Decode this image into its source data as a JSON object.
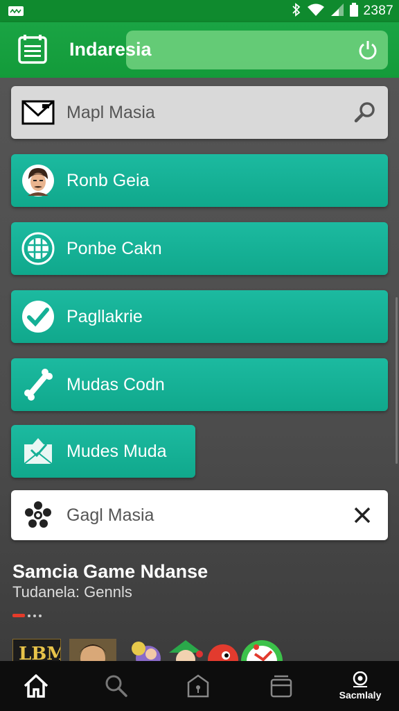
{
  "status_bar": {
    "time": "2387"
  },
  "app_bar": {
    "title": "Indaresia"
  },
  "search": {
    "placeholder": "Mapl Masia"
  },
  "menu_items": [
    {
      "label": "Ronb Geia",
      "icon": "avatar-icon"
    },
    {
      "label": "Ponbe Cakn",
      "icon": "grid-globe-icon"
    },
    {
      "label": "Pagllakrie",
      "icon": "check-icon"
    },
    {
      "label": "Mudas Codn",
      "icon": "bone-icon"
    },
    {
      "label": "Mudes Muda",
      "icon": "envelope-icon"
    }
  ],
  "filter_row": {
    "label": "Gagl Masia",
    "icon": "flower-icon",
    "close_icon": "close-icon"
  },
  "section": {
    "title": "Samcia Game Ndanse",
    "subtitle": "Tudanela: Gennls"
  },
  "game_tiles": [
    {
      "text": "LBM"
    },
    {
      "text": ""
    },
    {
      "text": ""
    },
    {
      "text": ""
    },
    {
      "text": ""
    },
    {
      "text": ""
    }
  ],
  "bottom_nav": [
    {
      "icon": "home-icon",
      "label": ""
    },
    {
      "icon": "search-icon",
      "label": ""
    },
    {
      "icon": "house-lock-icon",
      "label": ""
    },
    {
      "icon": "stack-icon",
      "label": ""
    },
    {
      "icon": "profile-icon",
      "label": "Sacmlaly"
    }
  ],
  "colors": {
    "primary": "#139b3a",
    "row": "#14b096",
    "nav": "#0d0d0d"
  }
}
